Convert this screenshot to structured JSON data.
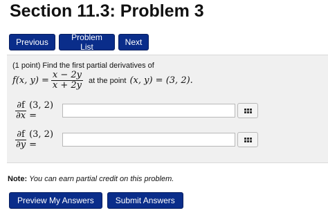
{
  "page": {
    "title": "Section 11.3: Problem 3"
  },
  "nav": {
    "previous": "Previous",
    "problem_list": "Problem List",
    "next": "Next"
  },
  "problem": {
    "intro": "(1 point) Find the first partial derivatives of",
    "func_lhs": "f(x, y) =",
    "numerator": "x − 2y",
    "denominator": "x + 2y",
    "at_point_text": "at the point",
    "point_eq": "(x, y) = (3, 2).",
    "rows": [
      {
        "partial": "∂f",
        "var": "∂x",
        "arg": "(3, 2) =",
        "value": ""
      },
      {
        "partial": "∂f",
        "var": "∂y",
        "arg": "(3, 2) =",
        "value": ""
      }
    ]
  },
  "note": {
    "label": "Note:",
    "text": "You can earn partial credit on this problem."
  },
  "actions": {
    "preview": "Preview My Answers",
    "submit": "Submit Answers"
  },
  "colors": {
    "button": "#0a2d8a",
    "panel": "#f0f0f0"
  }
}
